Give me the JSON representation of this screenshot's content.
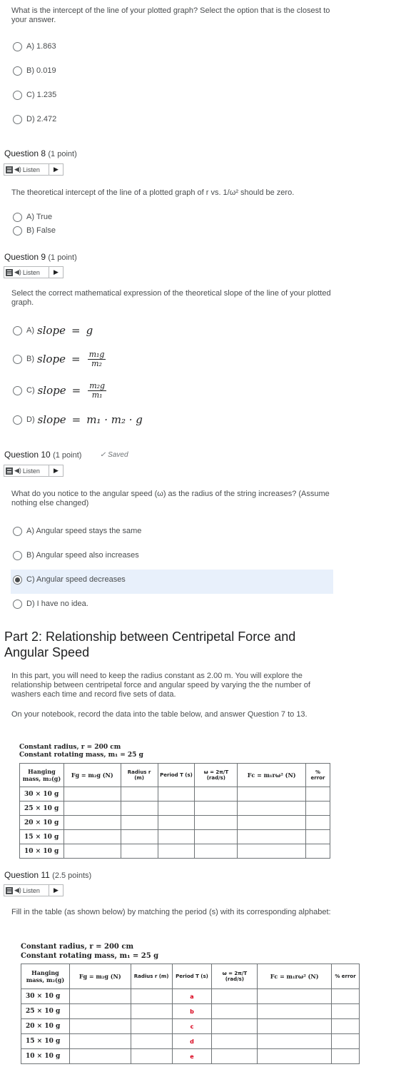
{
  "q7": {
    "text": "What is the intercept of the line of your plotted graph? Select the option that is the closest to your answer.",
    "options": [
      "A) 1.863",
      "B) 0.019",
      "C) 1.235",
      "D) 2.472"
    ]
  },
  "q8": {
    "title": "Question 8",
    "points": "(1 point)",
    "listen": "Listen",
    "text": "The theoretical intercept of the line of a plotted graph of r vs. 1/ω² should be zero.",
    "options": [
      "A) True",
      "B) False"
    ]
  },
  "q9": {
    "title": "Question 9",
    "points": "(1 point)",
    "listen": "Listen",
    "text": "Select the correct mathematical expression of the theoretical slope of the line of your plotted graph.",
    "options": [
      {
        "prefix": "A)",
        "lhs": "slope",
        "rhs": "g"
      },
      {
        "prefix": "B)",
        "lhs": "slope",
        "num": "m₁g",
        "den": "m₂"
      },
      {
        "prefix": "C)",
        "lhs": "slope",
        "num": "m₂g",
        "den": "m₁"
      },
      {
        "prefix": "D)",
        "lhs": "slope",
        "rhs": "m₁ · m₂ · g"
      }
    ]
  },
  "q10": {
    "title": "Question 10",
    "points": "(1 point)",
    "saved": "Saved",
    "listen": "Listen",
    "text": "What do you notice to the angular speed (ω) as the radius of the string increases? (Assume nothing else changed)",
    "options": [
      "A) Angular speed stays the same",
      "B) Angular speed also increases",
      "C) Angular speed decreases",
      "D) I have no idea."
    ],
    "selected_index": 2
  },
  "part2": {
    "heading": "Part 2: Relationship between Centripetal Force and Angular Speed",
    "para1": "In this part, you will need to keep the radius constant as 2.00 m. You will explore the relationship between centripetal force and angular speed by varying the the number of washers each time and record five sets of data.",
    "para2": "On your notebook, record the data into the table below, and answer Question 7 to 13."
  },
  "table": {
    "caption_radius": "Constant radius, r = 200 cm",
    "caption_mass": "Constant rotating mass, m₁ = 25 g",
    "headers": [
      "Hanging mass, m₂(g)",
      "Fg = m₂g (N)",
      "Radius r (m)",
      "Period T (s)",
      "ω = 2π/T (rad/s)",
      "Fc = m₁rω² (N)",
      "% error"
    ],
    "rows": [
      "30 × 10 g",
      "25 × 10 g",
      "20 × 10 g",
      "15 × 10 g",
      "10 × 10 g"
    ]
  },
  "q11": {
    "title": "Question 11",
    "points": "(2.5 points)",
    "listen": "Listen",
    "text": "Fill in the table (as shown below) by matching the period (s) with its corresponding alphabet:",
    "letters": [
      "a",
      "b",
      "c",
      "d",
      "e"
    ]
  }
}
